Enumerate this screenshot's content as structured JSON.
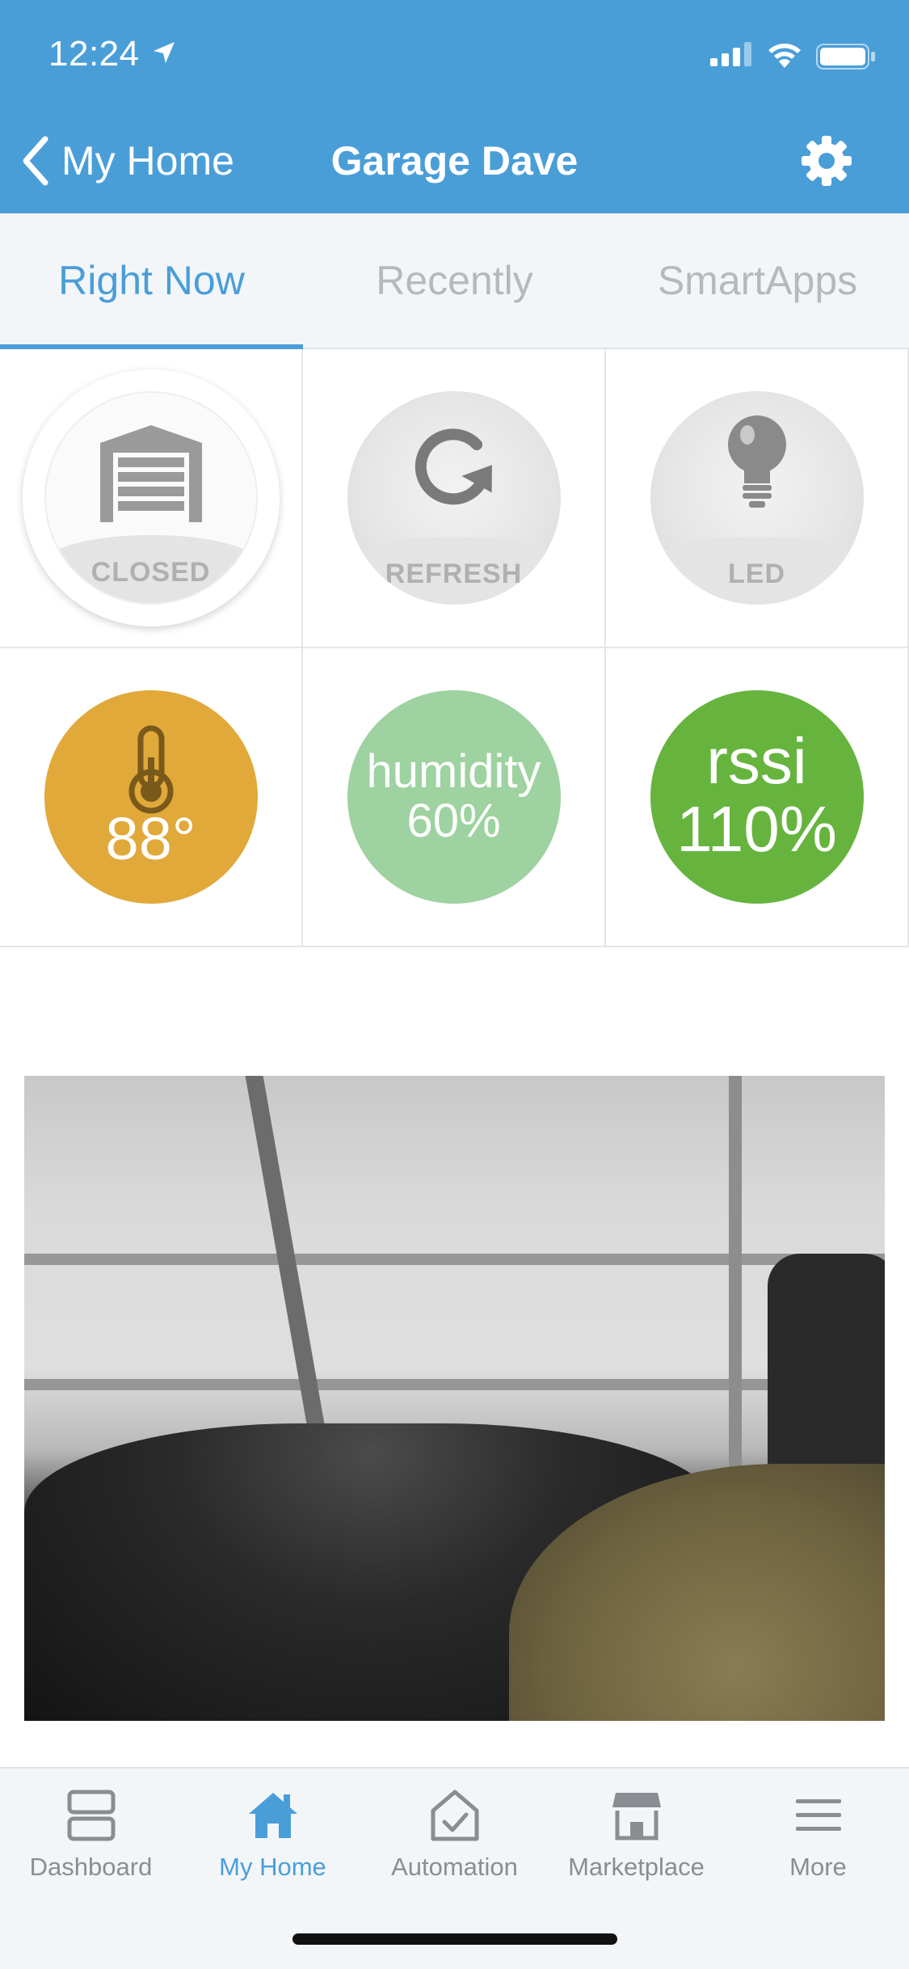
{
  "status_bar": {
    "time": "12:24"
  },
  "header": {
    "back_label": "My Home",
    "title": "Garage Dave"
  },
  "tabs": [
    {
      "label": "Right Now",
      "active": true
    },
    {
      "label": "Recently",
      "active": false
    },
    {
      "label": "SmartApps",
      "active": false
    }
  ],
  "tiles": {
    "door": {
      "label": "CLOSED",
      "icon": "garage-door-icon"
    },
    "refresh": {
      "label": "REFRESH",
      "icon": "refresh-icon"
    },
    "led": {
      "label": "LED",
      "icon": "lightbulb-icon"
    },
    "temperature": {
      "value": "88°",
      "icon": "thermometer-icon",
      "color": "#E0A93A"
    },
    "humidity": {
      "label": "humidity",
      "value": "60%",
      "color": "#9ED2A0"
    },
    "rssi": {
      "label": "rssi",
      "value": "110%",
      "color": "#66B43E"
    }
  },
  "nav": [
    {
      "label": "Dashboard",
      "icon": "dashboard-icon",
      "active": false
    },
    {
      "label": "My Home",
      "icon": "home-icon",
      "active": true
    },
    {
      "label": "Automation",
      "icon": "automation-icon",
      "active": false
    },
    {
      "label": "Marketplace",
      "icon": "marketplace-icon",
      "active": false
    },
    {
      "label": "More",
      "icon": "menu-icon",
      "active": false
    }
  ],
  "colors": {
    "accent": "#4A9ED8",
    "tab_inactive": "#B5B9BD",
    "nav_inactive": "#8A8E92"
  }
}
